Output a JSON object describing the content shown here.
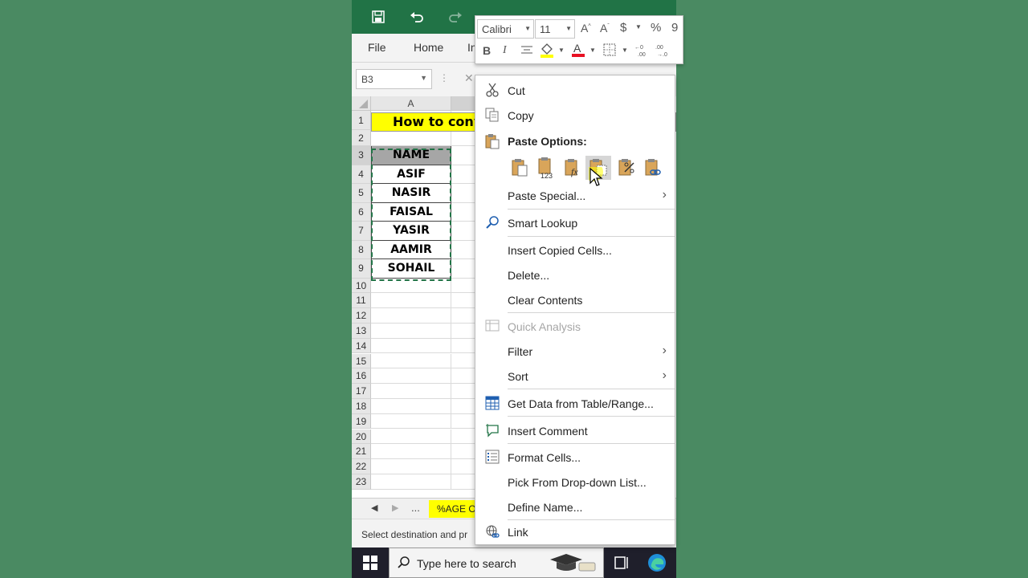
{
  "formula_bar": {
    "name_box": "B3"
  },
  "ribbon_tabs": [
    "File",
    "Home",
    "In"
  ],
  "mini_toolbar": {
    "font_name": "Calibri",
    "font_size": "11",
    "grow": "A",
    "shrink": "A",
    "currency": "$",
    "percent": "%",
    "comma": "9",
    "bold": "B",
    "italic": "I"
  },
  "columns": [
    "A"
  ],
  "title_cell": "How to conv",
  "rows": [
    {
      "num": "1",
      "a": ""
    },
    {
      "num": "2",
      "a": ""
    },
    {
      "num": "3",
      "a": "NAME"
    },
    {
      "num": "4",
      "a": "ASIF"
    },
    {
      "num": "5",
      "a": "NASIR"
    },
    {
      "num": "6",
      "a": "FAISAL"
    },
    {
      "num": "7",
      "a": "YASIR"
    },
    {
      "num": "8",
      "a": "AAMIR"
    },
    {
      "num": "9",
      "a": "SOHAIL"
    },
    {
      "num": "10",
      "a": ""
    },
    {
      "num": "11",
      "a": ""
    },
    {
      "num": "12",
      "a": ""
    },
    {
      "num": "13",
      "a": ""
    },
    {
      "num": "14",
      "a": ""
    },
    {
      "num": "15",
      "a": ""
    },
    {
      "num": "16",
      "a": ""
    },
    {
      "num": "17",
      "a": ""
    },
    {
      "num": "18",
      "a": ""
    },
    {
      "num": "19",
      "a": ""
    },
    {
      "num": "20",
      "a": ""
    },
    {
      "num": "21",
      "a": ""
    },
    {
      "num": "22",
      "a": ""
    },
    {
      "num": "23",
      "a": ""
    }
  ],
  "sheet_tabs": {
    "more": "...",
    "active": "%AGE O"
  },
  "status_bar": {
    "text": "Select destination and pr"
  },
  "taskbar": {
    "search_placeholder": "Type here to search"
  },
  "context_menu": {
    "cut": "Cut",
    "copy": "Copy",
    "paste_options": "Paste Options:",
    "paste_special": "Paste Special...",
    "smart_lookup": "Smart Lookup",
    "insert_copied_cells": "Insert Copied Cells...",
    "delete": "Delete...",
    "clear_contents": "Clear Contents",
    "quick_analysis": "Quick Analysis",
    "filter": "Filter",
    "sort": "Sort",
    "get_data": "Get Data from Table/Range...",
    "insert_comment": "Insert Comment",
    "format_cells": "Format Cells...",
    "pick_list": "Pick From Drop-down List...",
    "define_name": "Define Name...",
    "link": "Link"
  },
  "colors": {
    "excel_green": "#217346",
    "highlight_yellow": "#ffff00",
    "header_gray": "#a6a6a6",
    "background": "#4a8a62"
  }
}
